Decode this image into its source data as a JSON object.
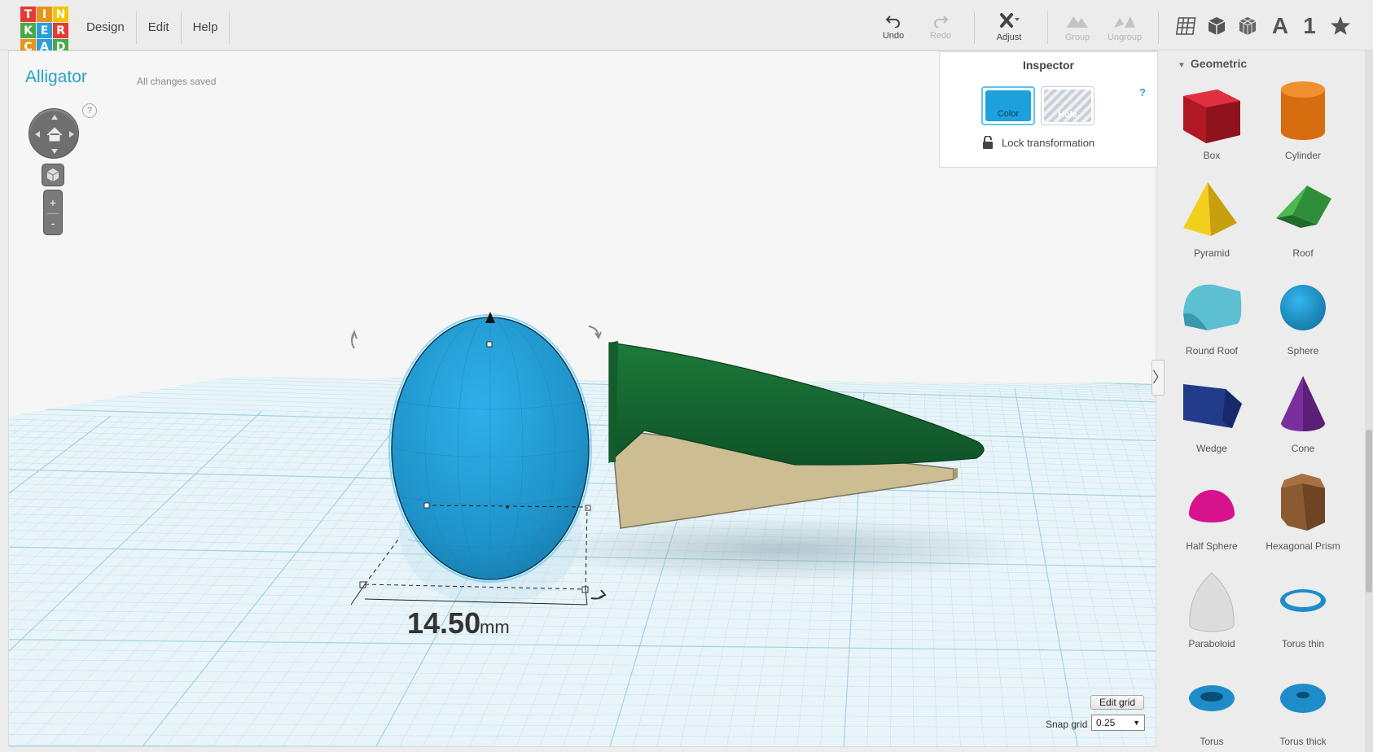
{
  "logo": {
    "letters": [
      "T",
      "I",
      "N",
      "K",
      "E",
      "R",
      "C",
      "A",
      "D"
    ],
    "colors": [
      "#e53935",
      "#e8941c",
      "#f5c400",
      "#4aa84a",
      "#2c9ed6",
      "#e53935",
      "#e8941c",
      "#2c9ed6",
      "#4aa84a"
    ]
  },
  "menu": [
    "Design",
    "Edit",
    "Help"
  ],
  "toolbar": {
    "undo": "Undo",
    "redo": "Redo",
    "adjust": "Adjust",
    "group": "Group",
    "ungroup": "Ungroup",
    "view_icons": [
      "grid-icon",
      "cube-icon",
      "wire-cube-icon",
      "text-letter-icon",
      "number-one-icon",
      "star-icon"
    ],
    "letter": "A",
    "number": "1"
  },
  "project": {
    "title": "Alligator",
    "status": "All changes saved"
  },
  "view_controls": {
    "help": "?",
    "zoom_in": "+",
    "zoom_out": "-"
  },
  "inspector": {
    "title": "Inspector",
    "help": "?",
    "color_label": "Color",
    "hole_label": "Hole",
    "lock_label": "Lock transformation",
    "selected_color": "#1ea0dc"
  },
  "canvas": {
    "dimension_value": "14.50",
    "dimension_unit": "mm",
    "colors": {
      "grid_bg": "#e8f4f8",
      "grid_line": "#9ccfe0",
      "selected": "#1e96d0",
      "snout": "#1f6e36",
      "jaw": "#cdbd93"
    }
  },
  "grid_controls": {
    "edit_grid": "Edit grid",
    "snap_label": "Snap grid",
    "snap_value": "0.25"
  },
  "shapes_panel": {
    "category": "Geometric",
    "shapes": [
      "Box",
      "Cylinder",
      "Pyramid",
      "Roof",
      "Round Roof",
      "Sphere",
      "Wedge",
      "Cone",
      "Half Sphere",
      "Hexagonal Prism",
      "Paraboloid",
      "Torus thin",
      "Torus",
      "Torus thick"
    ]
  }
}
